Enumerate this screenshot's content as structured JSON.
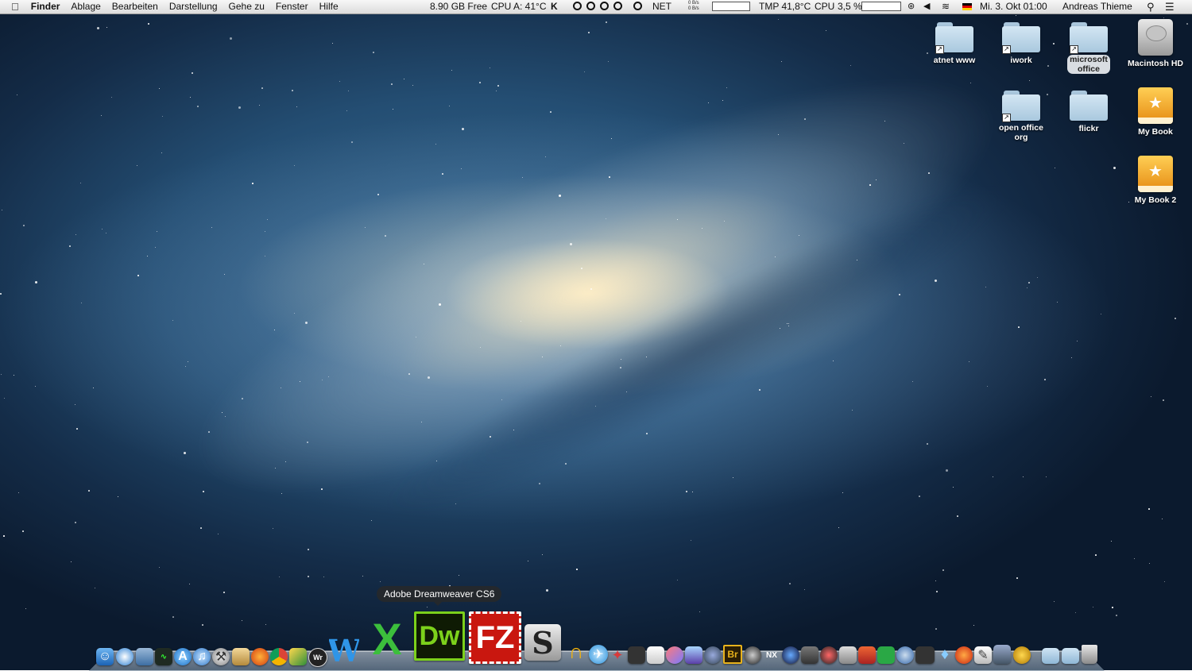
{
  "menubar": {
    "apple_icon": "apple-logo-icon",
    "app_name": "Finder",
    "menus": [
      "Ablage",
      "Bearbeiten",
      "Darstellung",
      "Gehe zu",
      "Fenster",
      "Hilfe"
    ],
    "status": {
      "disk_free": "8.90 GB Free",
      "cpu_temp": "CPU A: 41°C",
      "net_label": "NET",
      "net_rates_top": "0 B/s",
      "net_rates_bottom": "0 B/s",
      "tmp": "TMP 41,8°C",
      "cpu_label": "CPU",
      "cpu_load": "3,5 %",
      "clock": "Mi. 3. Okt  01:00",
      "user": "Andreas Thieme",
      "flag_color": "#ffce00"
    }
  },
  "desktop_icons": [
    {
      "label": "atnet www",
      "kind": "folder-alias"
    },
    {
      "label": "iwork",
      "kind": "folder-alias"
    },
    {
      "label": "microsoft office",
      "kind": "folder-alias"
    },
    {
      "label": "Macintosh HD",
      "kind": "hard-drive"
    },
    {
      "label": "open office org",
      "kind": "folder-alias"
    },
    {
      "label": "flickr",
      "kind": "folder"
    },
    {
      "label": "My Book",
      "kind": "external-drive"
    },
    {
      "label": "My Book 2",
      "kind": "external-drive"
    }
  ],
  "dock": {
    "tooltip": "Adobe Dreamweaver CS6",
    "big_labels": {
      "dreamweaver": "Dw",
      "filezilla": "FZ",
      "excel": "X",
      "scrivener": "S",
      "word": "W",
      "bridge": "Br",
      "nx": "NX"
    }
  }
}
